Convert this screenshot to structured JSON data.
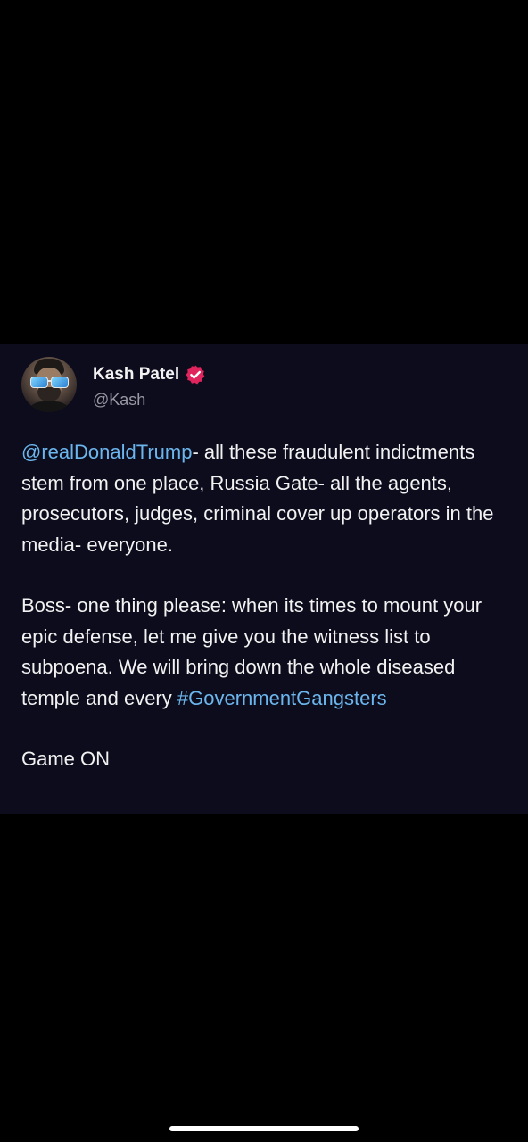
{
  "post": {
    "author": {
      "display_name": "Kash Patel",
      "handle": "@Kash",
      "verified_icon": "verified-badge-icon",
      "verified_color": "#e0245e"
    },
    "paragraph1": {
      "mention": "@realDonaldTrump",
      "text": "- all these fraudulent indictments stem from one place, Russia Gate- all the agents, prosecutors, judges, criminal cover up operators in the media- everyone."
    },
    "paragraph2": {
      "text": "Boss- one thing please: when its times to mount your epic defense, let me give you the witness list to subpoena. We will bring down the whole diseased temple and every ",
      "hashtag": "#GovernmentGangsters"
    },
    "paragraph3": {
      "text": "Game ON"
    }
  },
  "colors": {
    "background": "#000000",
    "card_background": "#0c0c1c",
    "link": "#6cb6ee",
    "text": "#f2f2f2",
    "secondary_text": "#9a9aa6"
  }
}
